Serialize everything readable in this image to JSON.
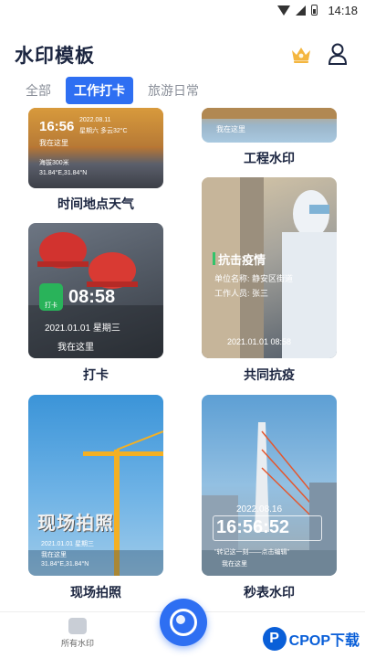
{
  "status_bar": {
    "time": "14:18"
  },
  "header": {
    "title": "水印模板",
    "crown_icon": "crown-icon",
    "user_icon": "user-icon"
  },
  "tabs": [
    {
      "label": "全部",
      "active": false
    },
    {
      "label": "工作打卡",
      "active": true
    },
    {
      "label": "旅游日常",
      "active": false
    }
  ],
  "templates": [
    {
      "name": "时间地点天气",
      "overlay": {
        "time": "16:56",
        "date": "2022.08.11",
        "week_weather": "星期六 多云32°C",
        "location": "我在这里",
        "altitude": "海拔300米",
        "coords": "31.84°E,31.84°N"
      }
    },
    {
      "name": "工程水印",
      "overlay": {
        "location": "我在这里"
      }
    },
    {
      "name": "打卡",
      "overlay": {
        "badge": "打卡",
        "time": "08:58",
        "date": "2021.01.01 星期三",
        "location": "我在这里"
      }
    },
    {
      "name": "共同抗疫",
      "overlay": {
        "title": "抗击疫情",
        "unit": "单位名称: 静安区街道",
        "staff": "工作人员: 张三",
        "datetime": "2021.01.01 08:58"
      }
    },
    {
      "name": "现场拍照",
      "overlay": {
        "title": "现场拍照",
        "line1": "2021.01.01 星期三",
        "line2": "我在这里",
        "line3": "31.84°E,31.84°N"
      }
    },
    {
      "name": "秒表水印",
      "overlay": {
        "date": "2022.08.16",
        "time": "16:56:52",
        "note": "\"转记这一刻——点击编辑\"",
        "location": "我在这里"
      }
    }
  ],
  "bottom_nav": {
    "left_label": "所有水印"
  },
  "watermark": {
    "text": "CPOP下载",
    "letter": "P"
  },
  "colors": {
    "accent": "#2e6ff2",
    "title": "#1b2540"
  }
}
